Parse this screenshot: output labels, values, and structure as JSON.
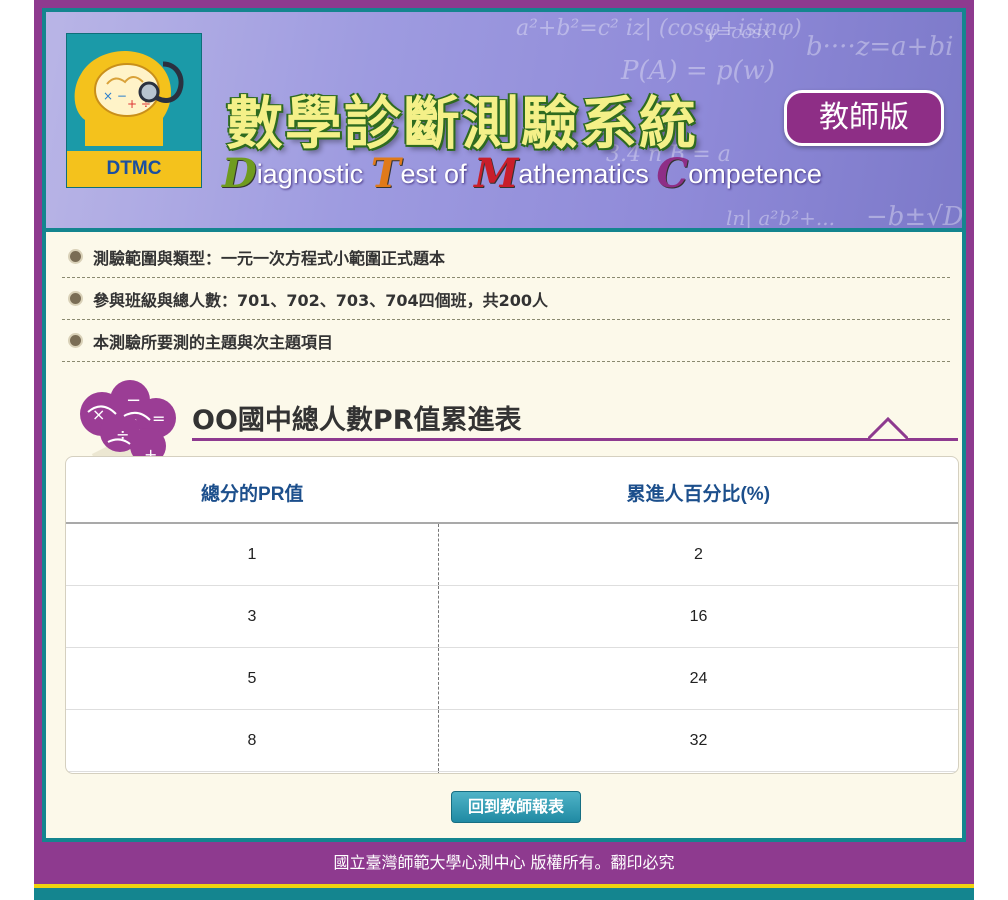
{
  "header": {
    "logo_label": "DTMC",
    "title_cn": "數學診斷測驗系統",
    "badge": "教師版",
    "title_en": {
      "d_cap": "D",
      "d_rest": "iagnostic ",
      "t_cap": "T",
      "t_rest": "est of ",
      "m_cap": "M",
      "m_rest": "athematics ",
      "c_cap": "C",
      "c_rest": "ompetence"
    },
    "colors": {
      "cap_green": "#6f9b1f",
      "cap_orange": "#e07a1a",
      "cap_red": "#c81e2a",
      "cap_purple": "#8e2e86"
    }
  },
  "info": [
    "測驗範圍與類型：一元一次方程式小範圍正式題本",
    "參與班級與總人數：701、702、703、704四個班，共200人",
    "本測驗所要測的主題與次主題項目"
  ],
  "section": {
    "title": "OO國中總人數PR值累進表"
  },
  "table": {
    "headers": [
      "總分的PR值",
      "累進人百分比(%)"
    ],
    "rows": [
      [
        "1",
        "2"
      ],
      [
        "3",
        "16"
      ],
      [
        "5",
        "24"
      ],
      [
        "8",
        "32"
      ]
    ]
  },
  "buttons": {
    "back": "回到教師報表"
  },
  "footer": {
    "copyright": "國立臺灣師範大學心測中心 版權所有。翻印必究"
  }
}
